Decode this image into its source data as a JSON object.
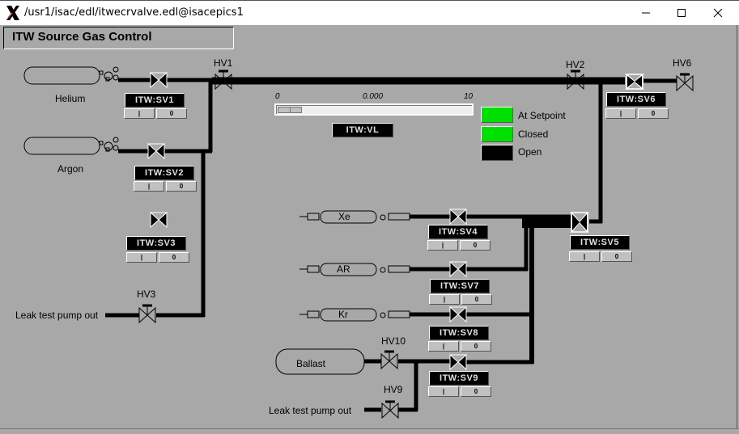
{
  "window": {
    "title": "/usr1/isac/edl/itwecrvalve.edl@isacepics1",
    "app_icon": "x-window-icon",
    "controls": {
      "minimize": "minimize-icon",
      "maximize": "maximize-icon",
      "close": "close-icon"
    }
  },
  "panel": {
    "title": "ITW Source Gas Control"
  },
  "gas_sources": {
    "helium": "Helium",
    "argon": "Argon",
    "xe": "Xe",
    "ar": "AR",
    "kr": "Kr",
    "ballast": "Ballast"
  },
  "hand_valves": {
    "hv1": "HV1",
    "hv2": "HV2",
    "hv3": "HV3",
    "hv6": "HV6",
    "hv9": "HV9",
    "hv10": "HV10"
  },
  "solenoid_valves": [
    {
      "id": "sv1",
      "pv": "ITW:SV1",
      "open_label": "|",
      "close_label": "0",
      "state": "closed"
    },
    {
      "id": "sv2",
      "pv": "ITW:SV2",
      "open_label": "|",
      "close_label": "0",
      "state": "closed"
    },
    {
      "id": "sv3",
      "pv": "ITW:SV3",
      "open_label": "|",
      "close_label": "0",
      "state": "closed"
    },
    {
      "id": "sv4",
      "pv": "ITW:SV4",
      "open_label": "|",
      "close_label": "0",
      "state": "closed"
    },
    {
      "id": "sv5",
      "pv": "ITW:SV5",
      "open_label": "|",
      "close_label": "0",
      "state": "closed"
    },
    {
      "id": "sv6",
      "pv": "ITW:SV6",
      "open_label": "|",
      "close_label": "0",
      "state": "closed"
    },
    {
      "id": "sv7",
      "pv": "ITW:SV7",
      "open_label": "|",
      "close_label": "0",
      "state": "closed"
    },
    {
      "id": "sv8",
      "pv": "ITW:SV8",
      "open_label": "|",
      "close_label": "0",
      "state": "closed"
    },
    {
      "id": "sv9",
      "pv": "ITW:SV9",
      "open_label": "|",
      "close_label": "0",
      "state": "closed"
    }
  ],
  "leak_valve": {
    "pv": "ITW:VL",
    "min_label": "0",
    "max_label": "10",
    "readback": "0.000",
    "value": 0.0
  },
  "legend": [
    {
      "label": "At Setpoint",
      "color": "#00e000"
    },
    {
      "label": "Closed",
      "color": "#00e000"
    },
    {
      "label": "Open",
      "color": "#000000"
    }
  ],
  "pump_outs": {
    "left": "Leak test pump out",
    "bottom": "Leak test pump out"
  }
}
